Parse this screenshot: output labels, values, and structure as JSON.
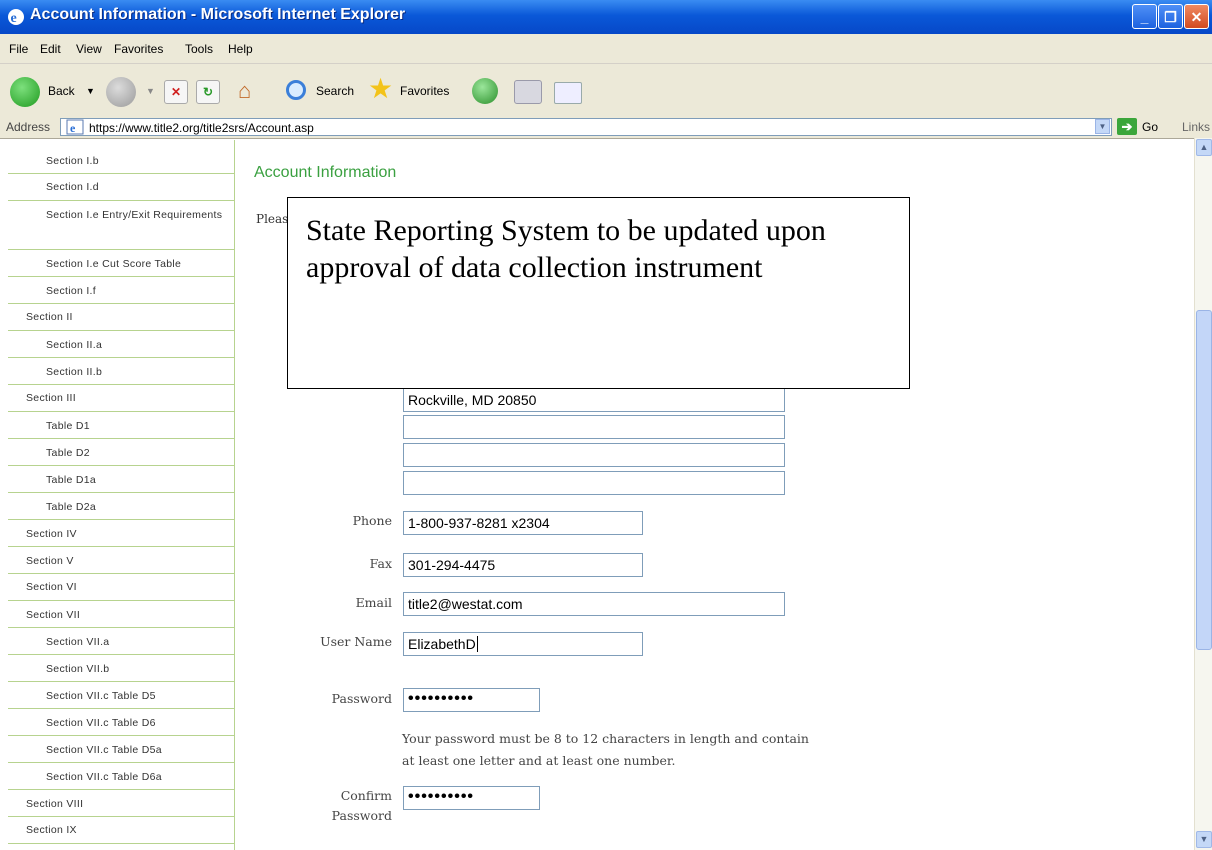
{
  "window": {
    "title": "Account Information - Microsoft Internet Explorer"
  },
  "menu": [
    "File",
    "Edit",
    "View",
    "Favorites",
    "Tools",
    "Help"
  ],
  "toolbar": {
    "back_label": "Back",
    "search_label": "Search",
    "favorites_label": "Favorites"
  },
  "address": {
    "label": "Address",
    "url": "https://www.title2.org/title2srs/Account.asp",
    "go_label": "Go",
    "links_label": "Links"
  },
  "sidebar": {
    "items": [
      {
        "label": "Section I.b",
        "level": "sub"
      },
      {
        "label": "Section I.d",
        "level": "sub"
      },
      {
        "label": "Section I.e Entry/Exit Requirements",
        "level": "sub"
      },
      {
        "label": "Section I.e Cut Score Table",
        "level": "sub"
      },
      {
        "label": "Section I.f",
        "level": "sub"
      },
      {
        "label": "Section II",
        "level": "top"
      },
      {
        "label": "Section II.a",
        "level": "sub"
      },
      {
        "label": "Section II.b",
        "level": "sub"
      },
      {
        "label": "Section III",
        "level": "top"
      },
      {
        "label": "Table D1",
        "level": "sub"
      },
      {
        "label": "Table D2",
        "level": "sub"
      },
      {
        "label": "Table D1a",
        "level": "sub"
      },
      {
        "label": "Table D2a",
        "level": "sub"
      },
      {
        "label": "Section IV",
        "level": "top"
      },
      {
        "label": "Section V",
        "level": "top"
      },
      {
        "label": "Section VI",
        "level": "top"
      },
      {
        "label": "Section VII",
        "level": "top"
      },
      {
        "label": "Section VII.a",
        "level": "sub"
      },
      {
        "label": "Section VII.b",
        "level": "sub"
      },
      {
        "label": "Section VII.c Table D5",
        "level": "sub"
      },
      {
        "label": "Section VII.c Table D6",
        "level": "sub"
      },
      {
        "label": "Section VII.c Table D5a",
        "level": "sub"
      },
      {
        "label": "Section VII.c Table D6a",
        "level": "sub"
      },
      {
        "label": "Section VIII",
        "level": "top"
      },
      {
        "label": "Section IX",
        "level": "top"
      }
    ]
  },
  "main": {
    "title": "Account Information",
    "intro_partial": "Pleas",
    "overlay_text": "State Reporting System to be updated upon approval of data collection instrument",
    "address_line": "Rockville, MD 20850",
    "address_extra": [
      "",
      "",
      ""
    ],
    "phone_label": "Phone",
    "phone": "1-800-937-8281 x2304",
    "fax_label": "Fax",
    "fax": "301-294-4475",
    "email_label": "Email",
    "email": "title2@westat.com",
    "username_label": "User Name",
    "username": "ElizabethD",
    "password_label": "Password",
    "password": "••••••••••",
    "password_hint": "Your password must be 8 to 12 characters in length and contain at least one letter and at least one number.",
    "confirm_label": "Confirm Password",
    "confirm": "••••••••••"
  },
  "colors": {
    "titlebar": "#0a58d8",
    "accent_green": "#3aa040",
    "nav_border": "#b7d38f"
  }
}
